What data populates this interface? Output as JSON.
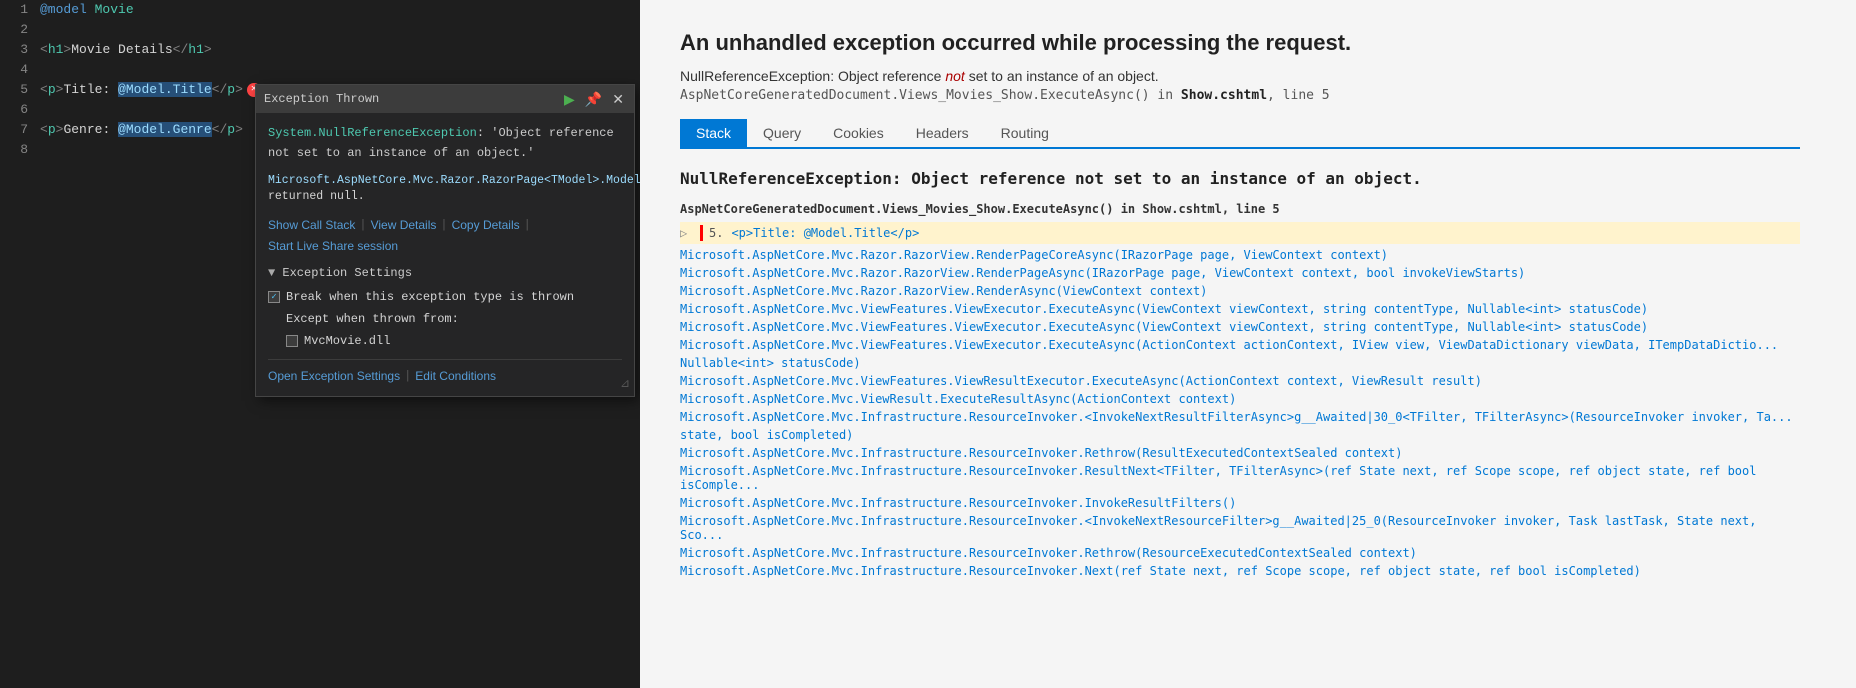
{
  "editor": {
    "lines": [
      {
        "num": "1",
        "content": "@model Movie",
        "type": "razor"
      },
      {
        "num": "2",
        "content": "",
        "type": "blank"
      },
      {
        "num": "3",
        "content": "<h1>Movie Details</h1>",
        "type": "html"
      },
      {
        "num": "4",
        "content": "",
        "type": "blank"
      },
      {
        "num": "5",
        "content": "<p>Title: @Model.Title</p>",
        "type": "error-line"
      },
      {
        "num": "6",
        "content": "",
        "type": "blank"
      },
      {
        "num": "7",
        "content": "<p>Genre: @Model.Genre</p>",
        "type": "html"
      },
      {
        "num": "8",
        "content": "",
        "type": "blank"
      }
    ]
  },
  "exception_popup": {
    "title": "Exception Thrown",
    "exception_type": "System.NullReferenceException",
    "exception_message": "'Object reference not set to an instance of an object.'",
    "detail_method": "Microsoft.AspNetCore.Mvc.Razor.RazorPage<TModel>.Model.get",
    "detail_result": "returned null.",
    "links": {
      "show_call_stack": "Show Call Stack",
      "view_details": "View Details",
      "copy_details": "Copy Details",
      "live_share": "Start Live Share session"
    },
    "settings_title": "Exception Settings",
    "break_label": "Break when this exception type is thrown",
    "except_label": "Except when thrown from:",
    "mvc_movie_dll": "MvcMovie.dll",
    "bottom_links": {
      "open_settings": "Open Exception Settings",
      "edit_conditions": "Edit Conditions"
    }
  },
  "browser": {
    "main_heading": "An unhandled exception occurred while processing the request.",
    "error_type": "NullReferenceException: Object reference ",
    "error_not": "not",
    "error_type2": " set to an instance of an object.",
    "source_method": "AspNetCoreGeneratedDocument.Views_Movies_Show.ExecuteAsync()",
    "source_in": "in ",
    "source_file": "Show.cshtml",
    "source_line": ", line 5",
    "tabs": [
      "Stack",
      "Query",
      "Cookies",
      "Headers",
      "Routing"
    ],
    "active_tab": "Stack",
    "stack_heading": "NullReferenceException: Object reference not set to an instance of an object.",
    "stack_frames": [
      {
        "method": "AspNetCoreGeneratedDocument.Views_Movies_Show.ExecuteAsync()",
        "suffix": " in Show.cshtml",
        "highlighted": false,
        "is_source": true
      },
      {
        "line_num": "5.",
        "method": "<p>Title: @Model.Title</p>",
        "highlighted": true,
        "is_highlighted": true
      },
      {
        "method": "Microsoft.AspNetCore.Mvc.Razor.RazorView.RenderPageCoreAsync(IRazorPage page, ViewContext context)",
        "highlighted": false
      },
      {
        "method": "Microsoft.AspNetCore.Mvc.Razor.RazorView.RenderPageAsync(IRazorPage page, ViewContext context, bool invokeViewStarts)",
        "highlighted": false
      },
      {
        "method": "Microsoft.AspNetCore.Mvc.Razor.RazorView.RenderAsync(ViewContext context)",
        "highlighted": false
      },
      {
        "method": "Microsoft.AspNetCore.Mvc.ViewFeatures.ViewExecutor.ExecuteAsync(ViewContext viewContext, string contentType, Nullable<int> statusCode)",
        "highlighted": false
      },
      {
        "method": "Microsoft.AspNetCore.Mvc.ViewFeatures.ViewExecutor.ExecuteAsync(ViewContext viewContext, string contentType, Nullable<int> statusCode)",
        "highlighted": false
      },
      {
        "method": "Microsoft.AspNetCore.Mvc.ViewFeatures.ViewExecutor.ExecuteAsync(ActionContext actionContext, IView view, ViewDataDictionary viewData, ITempDataDictio...",
        "highlighted": false
      },
      {
        "method": "Nullable<int> statusCode)",
        "highlighted": false
      },
      {
        "method": "Microsoft.AspNetCore.Mvc.ViewFeatures.ViewResultExecutor.ExecuteAsync(ActionContext context, ViewResult result)",
        "highlighted": false
      },
      {
        "method": "Microsoft.AspNetCore.Mvc.ViewResult.ExecuteResultAsync(ActionContext context)",
        "highlighted": false
      },
      {
        "method": "Microsoft.AspNetCore.Mvc.Infrastructure.ResourceInvoker.<InvokeNextResultFilterAsync>g__Awaited|30_0<TFilter, TFilterAsync>(ResourceInvoker invoker, Ta...",
        "highlighted": false
      },
      {
        "method": "state, bool isCompleted)",
        "highlighted": false
      },
      {
        "method": "Microsoft.AspNetCore.Mvc.Infrastructure.ResourceInvoker.Rethrow(ResultExecutedContextSealed context)",
        "highlighted": false
      },
      {
        "method": "Microsoft.AspNetCore.Mvc.Infrastructure.ResourceInvoker.ResultNext<TFilter, TFilterAsync>(ref State next, ref Scope scope, ref object state, ref bool isComple...",
        "highlighted": false
      },
      {
        "method": "Microsoft.AspNetCore.Mvc.Infrastructure.ResourceInvoker.InvokeResultFilters()",
        "highlighted": false
      },
      {
        "method": "Microsoft.AspNetCore.Mvc.Infrastructure.ResourceInvoker.<InvokeNextResourceFilter>g__Awaited|25_0(ResourceInvoker invoker, Task lastTask, State next, Sco...",
        "highlighted": false
      },
      {
        "method": "Microsoft.AspNetCore.Mvc.Infrastructure.ResourceInvoker.Rethrow(ResourceExecutedContextSealed context)",
        "highlighted": false
      },
      {
        "method": "Microsoft.AspNetCore.Mvc.Infrastructure.ResourceInvoker.Next(ref State next, ref Scope scope, ref object state, ref bool isCompleted)",
        "highlighted": false
      }
    ]
  }
}
